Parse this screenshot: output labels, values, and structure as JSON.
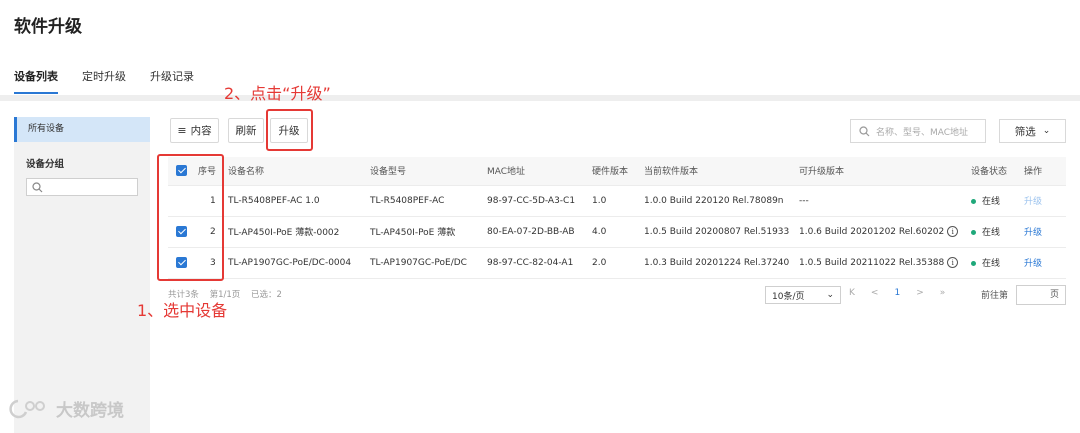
{
  "page": {
    "title": "软件升级"
  },
  "tabs": [
    {
      "label": "设备列表",
      "active": true
    },
    {
      "label": "定时升级",
      "active": false
    },
    {
      "label": "升级记录",
      "active": false
    }
  ],
  "sidebar": {
    "all_devices": "所有设备",
    "group_title": "设备分组"
  },
  "toolbar": {
    "content_label": "内容",
    "refresh_label": "刷新",
    "upgrade_label": "升级",
    "search_placeholder": "名称、型号、MAC地址",
    "filter_label": "筛选"
  },
  "table": {
    "columns": [
      "序号",
      "设备名称",
      "设备型号",
      "MAC地址",
      "硬件版本",
      "当前软件版本",
      "可升级版本",
      "设备状态",
      "操作"
    ],
    "rows": [
      {
        "index": "1",
        "name": "TL-R5408PEF-AC 1.0",
        "model": "TL-R5408PEF-AC",
        "mac": "98-97-CC-5D-A3-C1",
        "hw": "1.0",
        "current": "1.0.0 Build 220120 Rel.78089n",
        "upgradable": "---",
        "has_info": false,
        "status": "在线",
        "op": "升级",
        "checked": false
      },
      {
        "index": "2",
        "name": "TL-AP450I-PoE 薄款-0002",
        "model": "TL-AP450I-PoE 薄款",
        "mac": "80-EA-07-2D-BB-AB",
        "hw": "4.0",
        "current": "1.0.5 Build 20200807 Rel.51933",
        "upgradable": "1.0.6 Build 20201202 Rel.60202",
        "has_info": true,
        "status": "在线",
        "op": "升级",
        "checked": true
      },
      {
        "index": "3",
        "name": "TL-AP1907GC-PoE/DC-0004",
        "model": "TL-AP1907GC-PoE/DC",
        "mac": "98-97-CC-82-04-A1",
        "hw": "2.0",
        "current": "1.0.3 Build 20201224 Rel.37240",
        "upgradable": "1.0.5 Build 20211022 Rel.35388",
        "has_info": true,
        "status": "在线",
        "op": "升级",
        "checked": true
      }
    ],
    "header_checked": true
  },
  "footer": {
    "total": "共计3条",
    "page": "第1/1页",
    "selected": "已选：2",
    "page_size": "10条/页",
    "first": "K",
    "prev": "<",
    "current_page": "1",
    "next": ">",
    "last": "»",
    "goto_label": "前往第",
    "goto_unit": "页"
  },
  "annotations": {
    "step1": "1、选中设备",
    "step2": "2、点击“升级”"
  },
  "watermark": "大数跨境",
  "colors": {
    "accent": "#2a78d4",
    "annotation": "#e53935",
    "online": "#1fa87a"
  }
}
